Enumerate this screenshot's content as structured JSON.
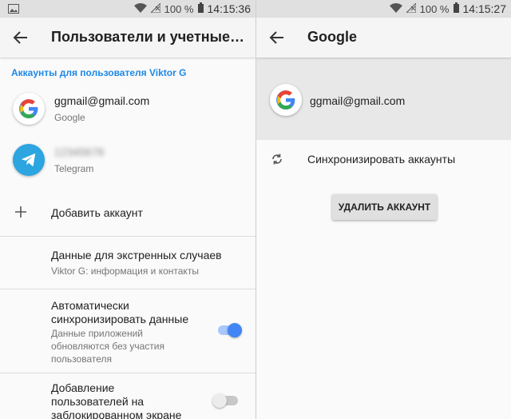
{
  "status": {
    "battery": "100 %",
    "time_left": "14:15:36",
    "time_right": "14:15:27"
  },
  "left": {
    "title": "Пользователи и учетные…",
    "section_header": "Аккаунты для пользователя Viktor G",
    "accounts": [
      {
        "primary": "ggmail@gmail.com",
        "secondary": "Google"
      },
      {
        "primary": "12345678",
        "secondary": "Telegram"
      }
    ],
    "add_account": "Добавить аккаунт",
    "emergency": {
      "primary": "Данные для экстренных случаев",
      "secondary": "Viktor G: информация и контакты"
    },
    "auto_sync": {
      "title_1": "Автоматически",
      "title_2": "синхронизировать данные",
      "sub_1": "Данные приложений",
      "sub_2": "обновляются без участия",
      "sub_3": "пользователя",
      "enabled": true
    },
    "lockscreen_users": {
      "title_1": "Добавление",
      "title_2": "пользователей на",
      "title_3": "заблокированном экране",
      "enabled": false
    }
  },
  "right": {
    "title": "Google",
    "account": "ggmail@gmail.com",
    "sync_label": "Синхронизировать аккаунты",
    "remove_button": "УДАЛИТЬ АККАУНТ"
  },
  "colors": {
    "accent": "#1e88e5",
    "toggle_on": "#4285f4",
    "telegram": "#2ca5e0"
  },
  "icons": [
    "image-icon",
    "wifi-icon",
    "no-signal-icon",
    "battery-icon",
    "back-arrow-icon",
    "google-logo-icon",
    "telegram-logo-icon",
    "plus-icon",
    "sync-icon"
  ]
}
